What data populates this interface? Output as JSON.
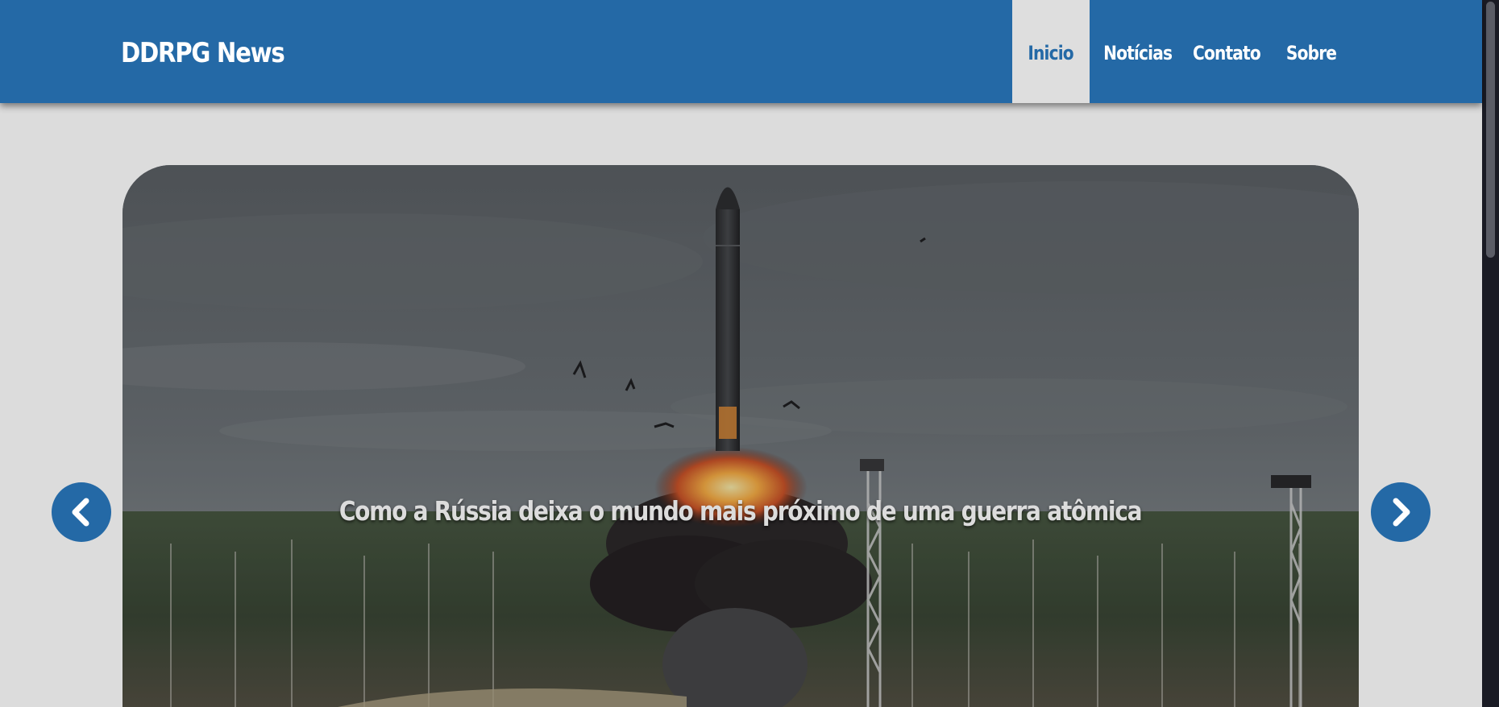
{
  "header": {
    "brand": "DDRPG News",
    "nav": [
      {
        "label": "Inicio",
        "active": true
      },
      {
        "label": "Notícias",
        "active": false
      },
      {
        "label": "Contato",
        "active": false
      },
      {
        "label": "Sobre",
        "active": false
      }
    ]
  },
  "carousel": {
    "caption": "Como a Rússia deixa o mundo mais próximo de uma guerra atômica",
    "prev_icon": "chevron-left-icon",
    "next_icon": "chevron-right-icon"
  },
  "colors": {
    "brand_blue": "#2469a6",
    "page_background": "#dcdcdc",
    "active_nav_background": "#dedede"
  }
}
